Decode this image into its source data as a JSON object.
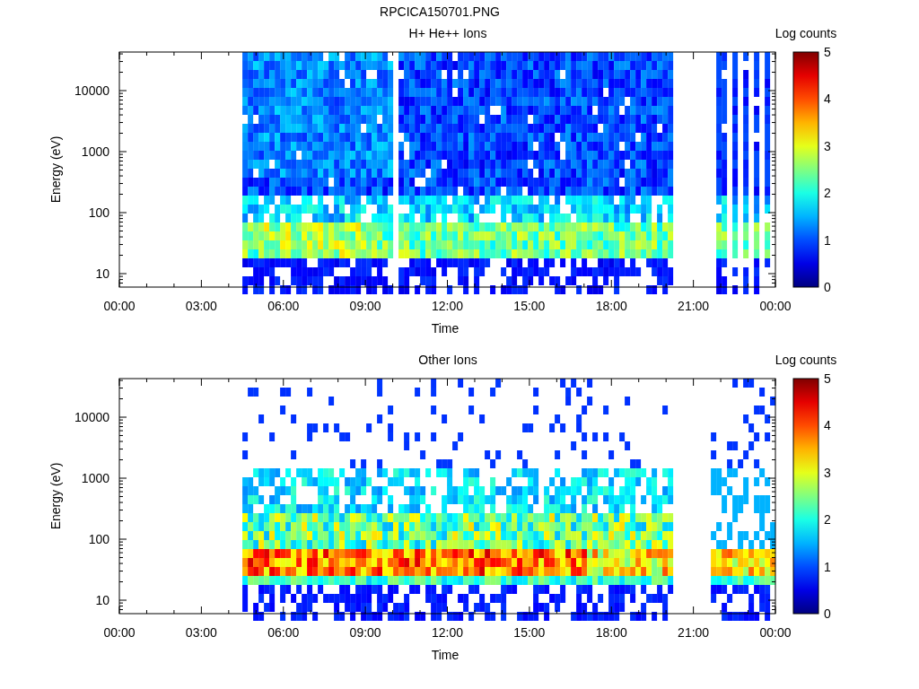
{
  "title": "RPCICA150701.PNG",
  "panels": [
    {
      "title": "H+ He++ Ions",
      "colorbar_label": "Log counts",
      "ylabel": "Energy (eV)",
      "xlabel": "Time",
      "yticks": [
        "10000",
        "1000",
        "100",
        "10"
      ],
      "xticks": [
        "00:00",
        "03:00",
        "06:00",
        "09:00",
        "12:00",
        "15:00",
        "18:00",
        "21:00",
        "00:00"
      ],
      "colorbar_ticks": [
        "5",
        "4",
        "3",
        "2",
        "1",
        "0"
      ]
    },
    {
      "title": "Other Ions",
      "colorbar_label": "Log counts",
      "ylabel": "Energy (eV)",
      "xlabel": "Time",
      "yticks": [
        "10000",
        "1000",
        "100",
        "10"
      ],
      "xticks": [
        "00:00",
        "03:00",
        "06:00",
        "09:00",
        "12:00",
        "15:00",
        "18:00",
        "21:00",
        "00:00"
      ],
      "colorbar_ticks": [
        "5",
        "4",
        "3",
        "2",
        "1",
        "0"
      ]
    }
  ]
}
